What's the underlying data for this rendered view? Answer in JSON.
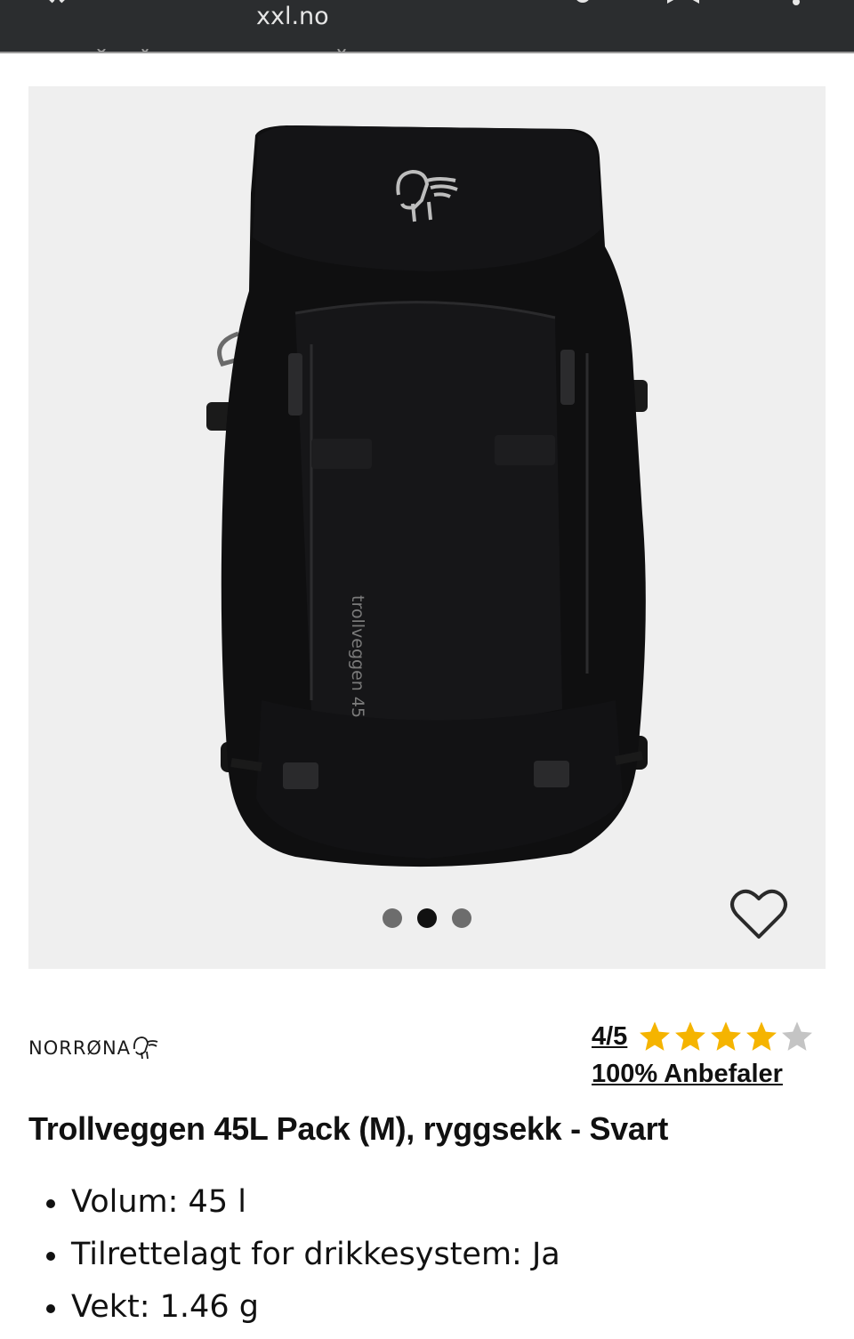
{
  "browser": {
    "url": "xxl.no"
  },
  "gallery": {
    "image_alt": "Trollveggen 45L Pack ryggsekk svart",
    "pack_print": "trollveggen 45",
    "slide_count": 3,
    "active_slide": 2
  },
  "product": {
    "brand": "NORRØNA",
    "rating": {
      "score_label": "4/5",
      "stars_filled": 4,
      "stars_total": 5,
      "recommend_label": "100% Anbefaler"
    },
    "title": "Trollveggen 45L Pack (M), ryggsekk - Svart",
    "specs": [
      "Volum: 45 l",
      "Tilrettelagt for drikkesystem: Ja",
      "Vekt: 1.46 g"
    ]
  },
  "colors": {
    "topbar": "#2b2d2f",
    "gallery_bg": "#efefef",
    "star_filled": "#f5b400",
    "star_empty": "#c4c4c4",
    "text": "#111111"
  },
  "icons": [
    "back-icon",
    "bookmark-icon",
    "menu-icon",
    "heart-icon",
    "star-icon",
    "norrona-logo-icon"
  ]
}
